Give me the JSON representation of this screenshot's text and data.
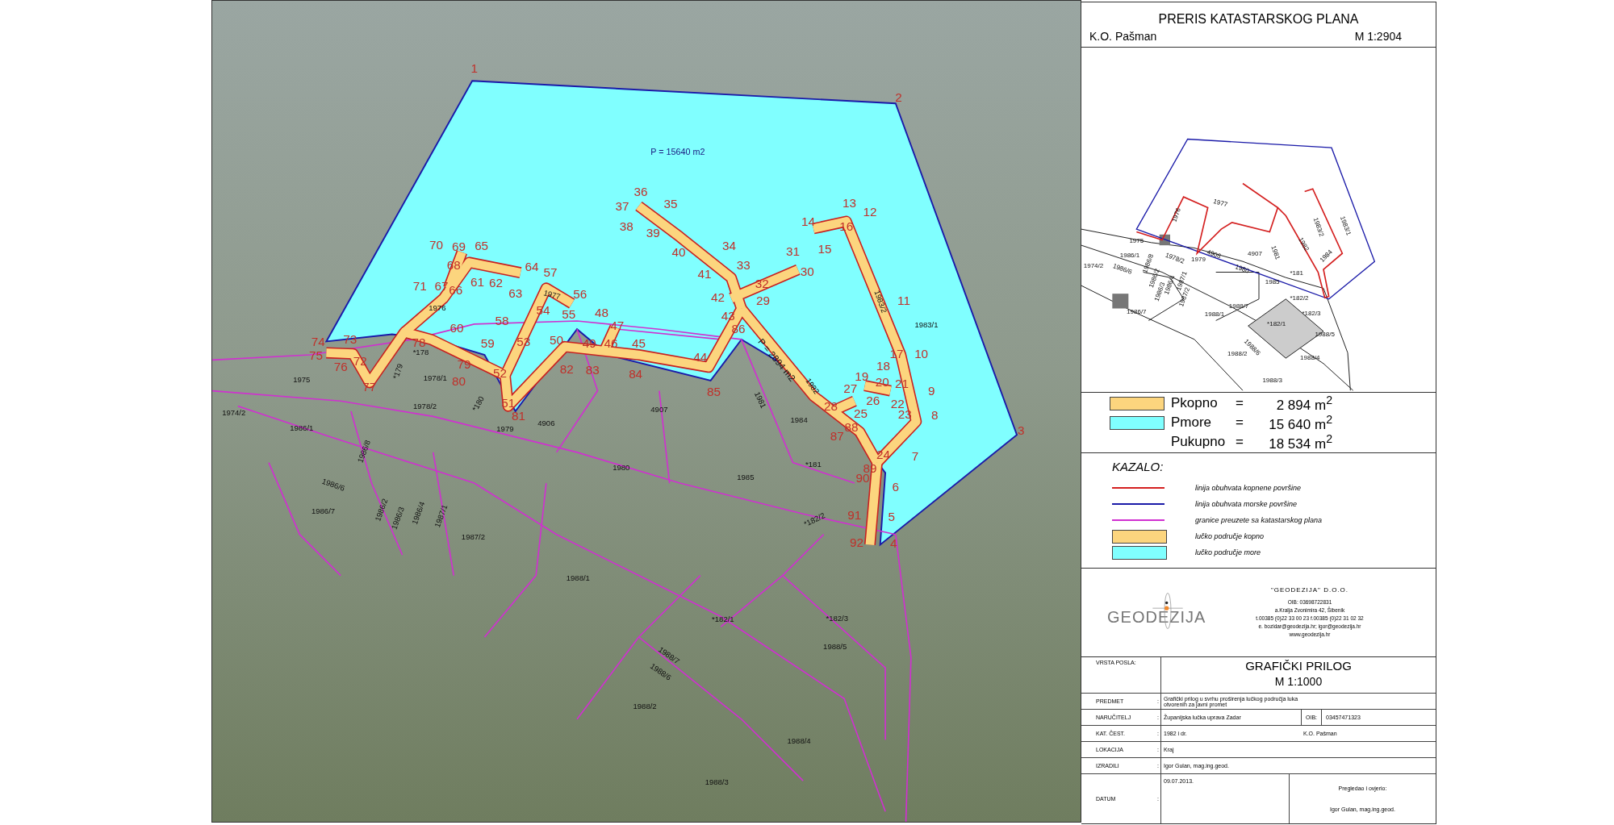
{
  "map": {
    "sea_area_label": "P = 15640 m2",
    "land_area_label": "P = 2894 m2",
    "points": [
      "1",
      "2",
      "36",
      "37",
      "35",
      "13",
      "12",
      "38",
      "39",
      "14",
      "16",
      "70",
      "69",
      "65",
      "40",
      "34",
      "31",
      "15",
      "68",
      "64",
      "57",
      "41",
      "33",
      "30",
      "71",
      "67",
      "66",
      "61",
      "62",
      "63",
      "56",
      "32",
      "42",
      "29",
      "11",
      "58",
      "54",
      "55",
      "48",
      "43",
      "60",
      "47",
      "86",
      "74",
      "73",
      "78",
      "59",
      "53",
      "50",
      "49",
      "46",
      "45",
      "75",
      "72",
      "44",
      "17",
      "10",
      "76",
      "79",
      "52",
      "82",
      "83",
      "84",
      "18",
      "77",
      "80",
      "85",
      "19",
      "27",
      "20",
      "21",
      "9",
      "51",
      "28",
      "26",
      "22",
      "81",
      "25",
      "23",
      "8",
      "88",
      "87",
      "3",
      "24",
      "7",
      "89",
      "90",
      "6",
      "91",
      "5",
      "92",
      "4"
    ],
    "parcels": [
      "1976",
      "1977",
      "*178",
      "*179",
      "1978/1",
      "1978/2",
      "*180",
      "1979",
      "4906",
      "4907",
      "1981",
      "1982",
      "1983/2",
      "1983/1",
      "1984",
      "*181",
      "1985",
      "1980",
      "1975",
      "1974/2",
      "1986/1",
      "1986/8",
      "1986/6",
      "1986/7",
      "1986/2",
      "1986/3",
      "1986/4",
      "1987/1",
      "1987/2",
      "1988/1",
      "*182/2",
      "*182/1",
      "*182/3",
      "1988/7",
      "1988/6",
      "1988/5",
      "1988/2",
      "1988/4",
      "1988/3"
    ]
  },
  "panel": {
    "title": "PRERIS KATASTARSKOG PLANA",
    "cadastral_municipality": "K.O. Pašman",
    "scale": "M 1:2904",
    "inset_parcels": [
      "1977",
      "1976",
      "1975",
      "1979",
      "4906",
      "4907",
      "1981",
      "1982",
      "1983/2",
      "1983/1",
      "1984",
      "1980",
      "*181",
      "1985",
      "1986/1",
      "1974/2",
      "1986/6",
      "1978/2",
      "1986/8",
      "1986/2",
      "1986/3",
      "1986/4",
      "1987/1",
      "1987/2",
      "1986/7",
      "1988/1",
      "1988/7",
      "*182/1",
      "*182/2",
      "*182/3",
      "1988/5",
      "1988/6",
      "1988/2",
      "1988/4",
      "1988/3"
    ],
    "areas": [
      {
        "kind": "land",
        "name": "Pkopno",
        "equals": "=",
        "value": "2 894 m$^{2}$",
        "color": "#fcd57e"
      },
      {
        "kind": "sea",
        "name": "Pmore",
        "equals": "=",
        "value": "15 640 m$^{2}$",
        "color": "#80ffff"
      },
      {
        "kind": "total",
        "name": "Pukupno",
        "equals": "=",
        "value": "18 534 m$^{2}$"
      }
    ],
    "legend": {
      "title": "KAZALO:",
      "items": [
        {
          "kind": "line",
          "color": "#d42020",
          "label": "linija obuhvata kopnene površine"
        },
        {
          "kind": "line",
          "color": "#1a1aa8",
          "label": "linija obuhvata morske površine"
        },
        {
          "kind": "line",
          "color": "#d030d0",
          "label": "granice preuzete sa katastarskog plana"
        },
        {
          "kind": "fill",
          "color": "#fcd57e",
          "label": "lučko područje kopno"
        },
        {
          "kind": "fill",
          "color": "#80ffff",
          "label": "lučko područje more"
        }
      ]
    },
    "company": {
      "logo_text": "GEODEZIJA",
      "name": "\"GEODEZIJA\" D.O.O.",
      "lines": [
        "OIB: 03698722831",
        "a.Kralja Zvonimira 42, Šibenik",
        "t.00385 (0)22 33 00 23 f.00385 (0)22 31 02 32",
        "e. bozidar@geodezija.hr; igor@geodezija.hr",
        "www.geodezija.hr"
      ]
    },
    "title_block": {
      "work_type_label": "VRSTA POSLA:",
      "title": "GRAFIČKI PRILOG",
      "scale": "M 1:1000",
      "rows": [
        {
          "label": "PREDMET",
          "separator": ":",
          "value": "Grafički prilog u svrhu proširenja lučkog područja luka otvorenih za javni promet"
        },
        {
          "label": "NARUČITELJ",
          "separator": ":",
          "value": "Županijska lučka uprava Zadar",
          "extra_label": "OIB:",
          "extra_value": "03457471323"
        },
        {
          "label": "KAT. ČEST.",
          "separator": ":",
          "value": "1982 i dr.",
          "extra_value": "K.O.  Pašman"
        },
        {
          "label": "LOKACIJA",
          "separator": ":",
          "value": "Kraj"
        },
        {
          "label": "IZRADILI",
          "separator": ":",
          "value": "Igor Gulan, mag.ing.geod."
        }
      ],
      "date": {
        "label": "DATUM",
        "separator": ":",
        "value": "09.07.2013."
      },
      "approval": {
        "label": "Pregledao i ovjerio:",
        "name": "Igor Gulan, mag.ing.geod."
      }
    }
  }
}
